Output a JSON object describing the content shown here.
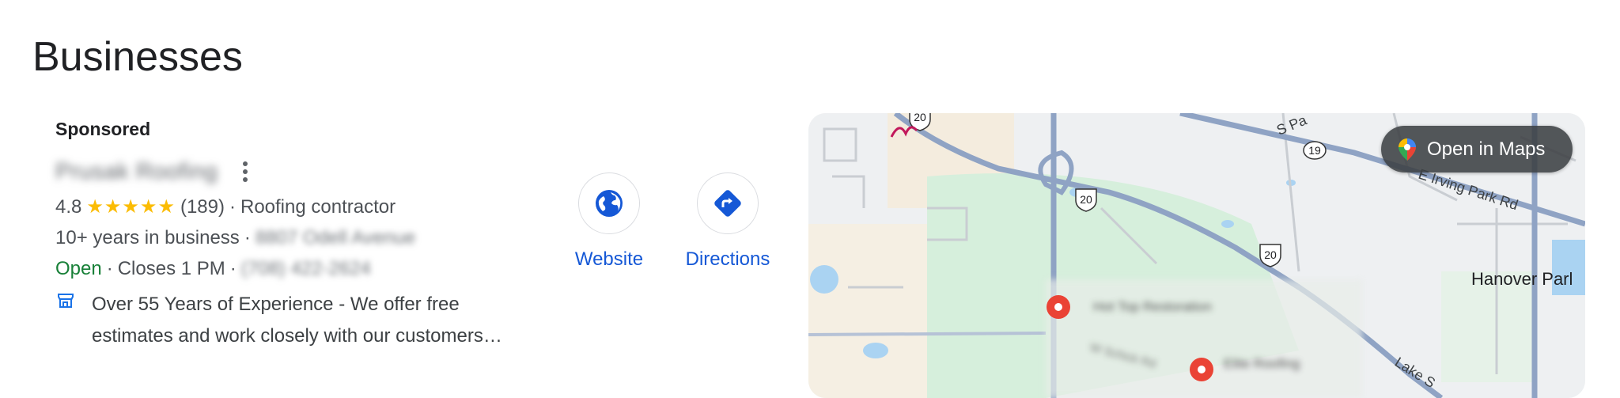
{
  "section": {
    "title": "Businesses"
  },
  "listing": {
    "sponsored_label": "Sponsored",
    "name": "Prusak Roofing",
    "rating": "4.8",
    "stars": "★★★★★",
    "review_count": "(189)",
    "category": "Roofing contractor",
    "years": "10+ years in business",
    "address": "8807 Odell Avenue",
    "status": "Open",
    "closes": "Closes 1 PM",
    "phone": "(708) 422-2624",
    "description": "Over 55 Years of Experience - We offer free estimates and work closely with our customers…",
    "sep": "·"
  },
  "actions": {
    "website_label": "Website",
    "directions_label": "Directions"
  },
  "map": {
    "open_in_maps_label": "Open in Maps",
    "place_label": "Hanover Parl",
    "road_labels": {
      "route_20_a": "20",
      "route_20_b": "20",
      "route_20_c": "20",
      "route_19": "19",
      "irving_park": "E Irving Park Rd",
      "s_pa": "S Pa",
      "lake": "Lake S"
    },
    "markers": [
      {
        "name": "Hot Top Restoration"
      },
      {
        "name": "Elite Roofing"
      }
    ],
    "blurred_road": "W Schick Rd"
  },
  "colors": {
    "link": "#1558d6",
    "open_green": "#188038",
    "star": "#fbbc04",
    "marker": "#ea4335"
  }
}
